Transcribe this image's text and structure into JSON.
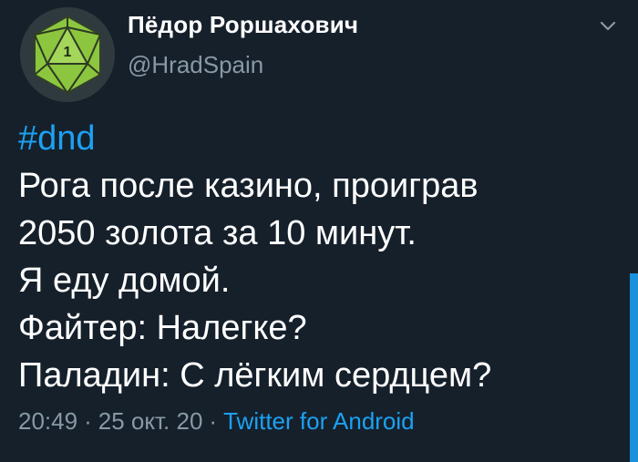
{
  "tweet": {
    "author": {
      "display_name": "Пёдор Роршахович",
      "handle": "@HradSpain",
      "avatar_label": "1"
    },
    "hashtag": "#dnd",
    "lines": [
      "Рога после казино, проиграв",
      "2050 золота за 10 минут.",
      "Я еду домой.",
      "Файтер: Налегке?",
      "Паладин: С лёгким сердцем?"
    ],
    "meta": {
      "time": "20:49",
      "separator": "·",
      "date": "25 окт. 20",
      "source": "Twitter for Android"
    }
  },
  "colors": {
    "background": "#15202b",
    "text": "#ffffff",
    "secondary_text": "#8899a6",
    "accent": "#1da1f2",
    "avatar_green": "#8cc63f"
  },
  "icons": {
    "menu": "chevron-down-icon",
    "avatar": "d20-dice-icon"
  }
}
